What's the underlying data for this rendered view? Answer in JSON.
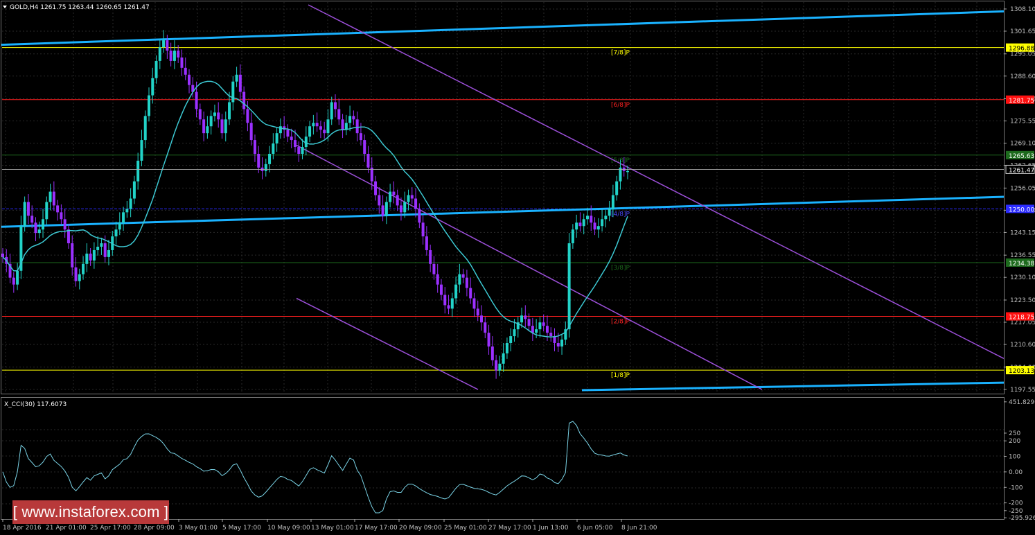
{
  "header": {
    "symbol_label": "GOLD,H4  1261.75 1263.44 1260.65 1261.47"
  },
  "indicator": {
    "label": "X_CCI(30) 117.6073"
  },
  "watermark": "[  www.instaforex.com ]",
  "colors": {
    "background": "#000000",
    "bull_candle": "#22d3c8",
    "bear_candle": "#9b30ff",
    "cyan_line": "#1ab2ff",
    "ma_line": "#3cc8d2",
    "channel": "#9b4fd8",
    "yellow_level": "#ffff00",
    "red_level": "#ff2020",
    "green_level": "#1d6a1d",
    "blue_level": "#2b2bff",
    "cci_line": "#7ad3e6",
    "axis_text": "#c0c0c0"
  },
  "chart_data": {
    "type": "candlestick",
    "price_axis": {
      "ticks": [
        1308.1,
        1301.65,
        1295.05,
        1288.6,
        1282.0,
        1275.55,
        1269.1,
        1262.65,
        1256.05,
        1249.6,
        1243.15,
        1236.55,
        1230.1,
        1223.5,
        1217.05,
        1210.6,
        1204.0,
        1197.55
      ],
      "range": [
        1196.5,
        1309.5
      ],
      "current_price": 1261.47
    },
    "time_axis": {
      "labels": [
        "18 Apr 2016",
        "21 Apr 01:00",
        "25 Apr 17:00",
        "28 Apr 09:00",
        "3 May 01:00",
        "5 May 17:00",
        "10 May 09:00",
        "13 May 01:00",
        "17 May 17:00",
        "20 May 09:00",
        "25 May 01:00",
        "27 May 17:00",
        "1 Jun 13:00",
        "6 Jun 05:00",
        "8 Jun 21:00"
      ]
    },
    "murrey_levels": [
      {
        "name": "[7/8]P",
        "price": 1296.88,
        "color": "yellow",
        "tag": "1296.88"
      },
      {
        "name": "[6/8]P",
        "price": 1281.75,
        "color": "red",
        "tag": "1281.75"
      },
      {
        "name": "[5/8]P",
        "price": 1265.63,
        "color": "green",
        "tag": "1265.63"
      },
      {
        "name": "[4/8]P",
        "price": 1250.0,
        "color": "blue",
        "tag": "1250.00"
      },
      {
        "name": "[3/8]P",
        "price": 1234.38,
        "color": "green",
        "tag": "1234.38"
      },
      {
        "name": "[2/8]P",
        "price": 1218.75,
        "color": "red",
        "tag": "1218.75"
      },
      {
        "name": "[1/8]P",
        "price": 1203.13,
        "color": "yellow",
        "tag": "1203.13"
      }
    ],
    "close_series": [
      1236,
      1234,
      1230,
      1228,
      1232,
      1245,
      1252,
      1248,
      1246,
      1243,
      1244,
      1247,
      1252,
      1255,
      1251,
      1249,
      1247,
      1244,
      1240,
      1233,
      1229,
      1231,
      1234,
      1237,
      1235,
      1238,
      1239,
      1240,
      1236,
      1238,
      1242,
      1244,
      1246,
      1249,
      1250,
      1253,
      1258,
      1264,
      1270,
      1277,
      1283,
      1288,
      1293,
      1297,
      1299,
      1296,
      1293,
      1296,
      1294,
      1291,
      1289,
      1286,
      1284,
      1279,
      1276,
      1272,
      1274,
      1277,
      1278,
      1276,
      1272,
      1276,
      1281,
      1287,
      1289,
      1284,
      1279,
      1275,
      1270,
      1266,
      1262,
      1261,
      1263,
      1266,
      1269,
      1272,
      1274,
      1273,
      1271,
      1270,
      1268,
      1266,
      1268,
      1271,
      1274,
      1275,
      1274,
      1273,
      1272,
      1276,
      1281,
      1279,
      1276,
      1273,
      1275,
      1277,
      1276,
      1272,
      1270,
      1266,
      1262,
      1258,
      1254,
      1251,
      1248,
      1252,
      1255,
      1254,
      1251,
      1249,
      1252,
      1254,
      1253,
      1250,
      1246,
      1242,
      1238,
      1234,
      1231,
      1228,
      1225,
      1222,
      1221,
      1224,
      1228,
      1231,
      1230,
      1227,
      1224,
      1221,
      1219,
      1217,
      1214,
      1210,
      1206,
      1203,
      1205,
      1208,
      1211,
      1213,
      1215,
      1217,
      1219,
      1218,
      1216,
      1214,
      1215,
      1217,
      1216,
      1214,
      1213,
      1211,
      1210,
      1212,
      1215,
      1240,
      1244,
      1246,
      1245,
      1247,
      1248,
      1246,
      1244,
      1245,
      1247,
      1248,
      1250,
      1254,
      1258,
      1262,
      1261,
      1261
    ]
  }
}
